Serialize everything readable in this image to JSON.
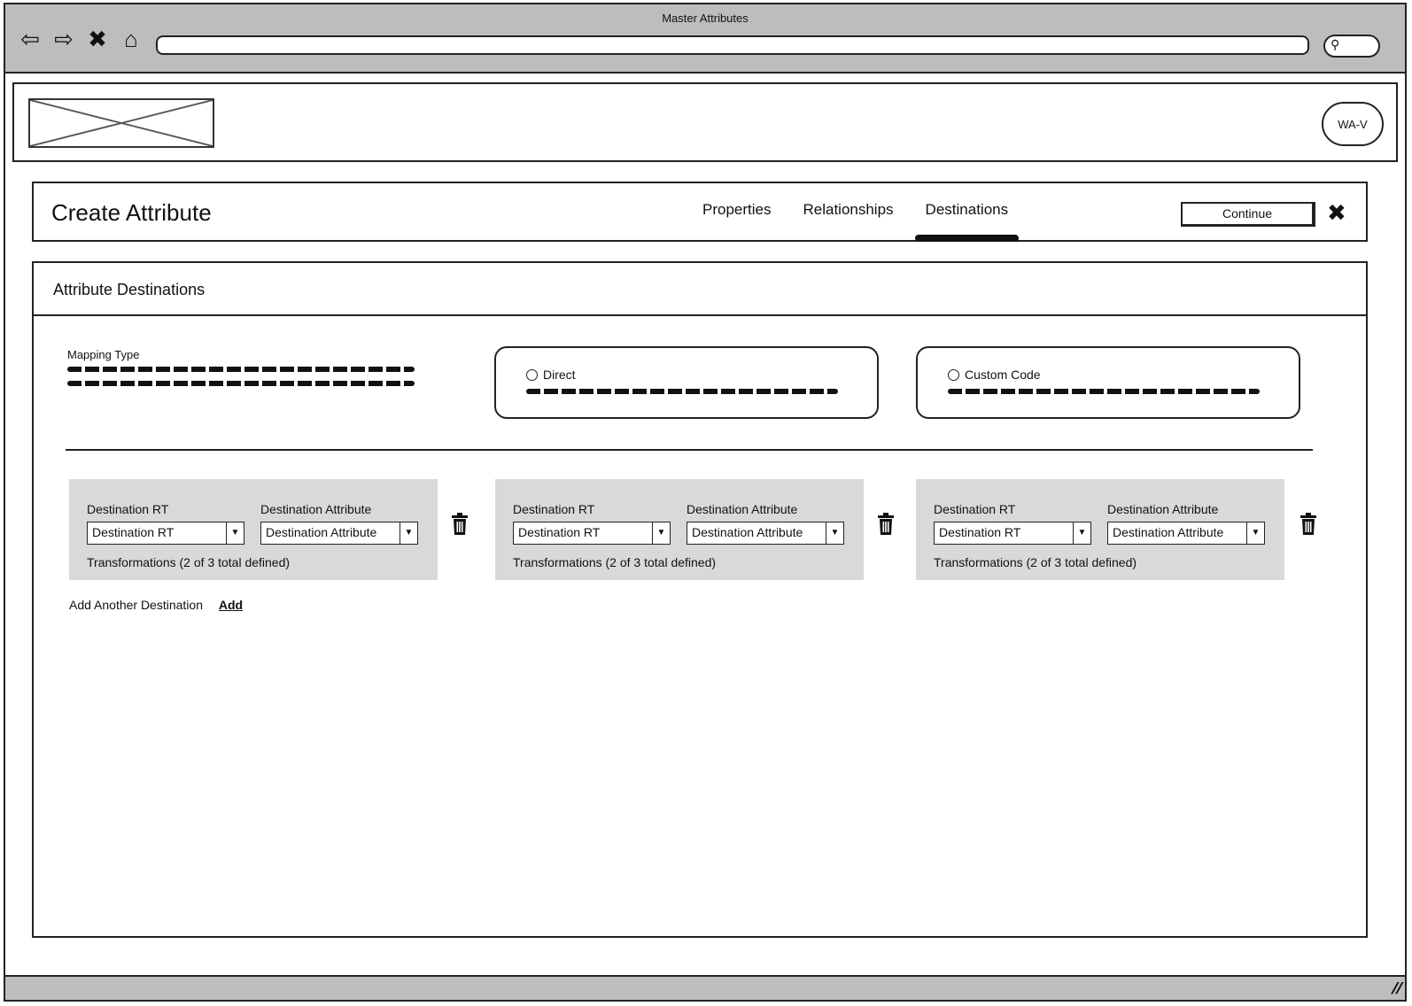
{
  "window": {
    "title": "Master Attributes"
  },
  "browser": {
    "nav": [
      {
        "name": "back-icon",
        "glyph": "⇦"
      },
      {
        "name": "forward-icon",
        "glyph": "⇨"
      },
      {
        "name": "stop-icon",
        "glyph": "✖"
      },
      {
        "name": "home-icon",
        "glyph": "⌂"
      }
    ],
    "search_icon": "search-icon"
  },
  "header": {
    "user_initials": "WA-V",
    "logo_icon": "image-placeholder-icon"
  },
  "page": {
    "title": "Create Attribute",
    "tabs": [
      {
        "label": "Properties",
        "active": false
      },
      {
        "label": "Relationships",
        "active": false
      },
      {
        "label": "Destinations",
        "active": true
      }
    ],
    "continue_label": "Continue",
    "close_icon": "close-icon"
  },
  "panel": {
    "title": "Attribute Destinations",
    "mapping_type": {
      "label": "Mapping Type"
    },
    "options": [
      {
        "label": "Direct",
        "selected": false
      },
      {
        "label": "Custom Code",
        "selected": false
      }
    ],
    "destinations": [
      {
        "rt_label": "Destination RT",
        "rt_value": "Destination RT",
        "attr_label": "Destination Attribute",
        "attr_value": "Destination Attribute",
        "transformations": "Transformations (2 of 3 total defined)"
      },
      {
        "rt_label": "Destination RT",
        "rt_value": "Destination RT",
        "attr_label": "Destination Attribute",
        "attr_value": "Destination Attribute",
        "transformations": "Transformations (2 of 3 total defined)"
      },
      {
        "rt_label": "Destination RT",
        "rt_value": "Destination RT",
        "attr_label": "Destination Attribute",
        "attr_value": "Destination Attribute",
        "transformations": "Transformations (2 of 3 total defined)"
      }
    ],
    "add_text": "Add Another Destination",
    "add_link": "Add"
  }
}
